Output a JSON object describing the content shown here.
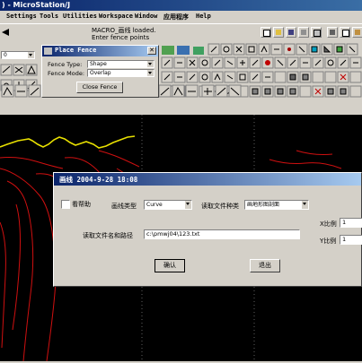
{
  "window": {
    "title": ") - MicroStation/J"
  },
  "menu": [
    "Settings",
    "Tools",
    "Utilities",
    "Workspace",
    "Window",
    "应用程序",
    "Help"
  ],
  "status": {
    "line1": "MACRO_画线 loaded.",
    "line2": "Enter fence points"
  },
  "level_value": "0",
  "place_fence": {
    "title": "Place Fence",
    "type_label": "Fence Type:",
    "type_value": "Shape",
    "mode_label": "Fence Mode:",
    "mode_value": "Overlap",
    "close_button": "Close Fence"
  },
  "dialog": {
    "title": "画线 2004-9-28 18:08",
    "help_checkbox": "看帮助",
    "curve_type_label": "画线类型",
    "curve_type_value": "Curve",
    "file_type_label": "读取文件种类",
    "file_type_value": "画地形图剖面",
    "file_path_label": "读取文件名和路径",
    "file_path_value": "c:\\pmwj04\\123.txt",
    "x_scale_label": "X比例",
    "x_scale_value": "1",
    "y_scale_label": "Y比例",
    "y_scale_value": "1",
    "ok_button": "确认",
    "exit_button": "退出"
  },
  "colors": {
    "titlebar": "#0a246a",
    "canvas": "#000000",
    "curve_red": "#d01010",
    "curve_yellow": "#e8e000"
  }
}
